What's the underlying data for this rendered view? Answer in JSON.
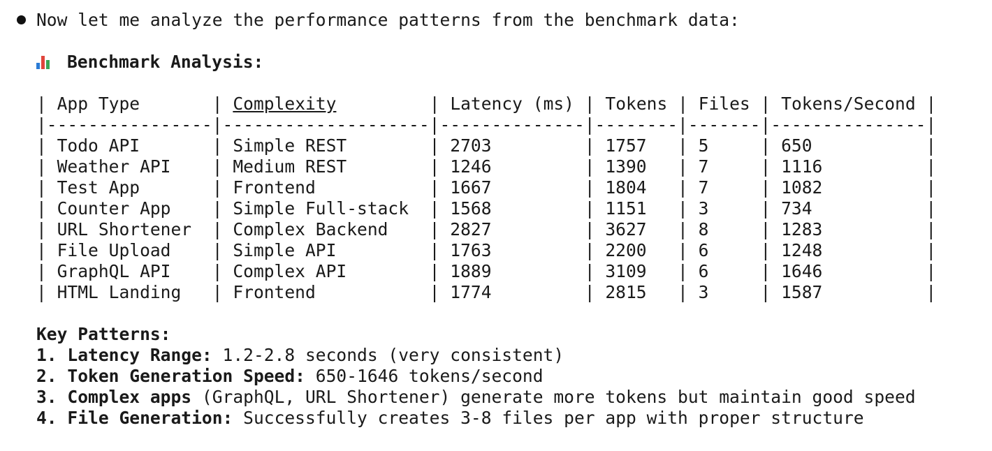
{
  "intro": {
    "text": "Now let me analyze the performance patterns from the benchmark data:"
  },
  "analysis": {
    "icon": "bar-chart-icon",
    "title": "Benchmark Analysis:"
  },
  "table": {
    "header_line": "| App Type       | Complexity         | Latency (ms) | Tokens | Files | Tokens/Second |",
    "headers": [
      "App Type",
      "Complexity",
      "Latency (ms)",
      "Tokens",
      "Files",
      "Tokens/Second"
    ],
    "separator": "|----------------|--------------------|--------------|--------|-------|---------------|",
    "rows": [
      "| Todo API       | Simple REST        | 2703         | 1757   | 5     | 650           |",
      "| Weather API    | Medium REST        | 1246         | 1390   | 7     | 1116          |",
      "| Test App       | Frontend           | 1667         | 1804   | 7     | 1082          |",
      "| Counter App    | Simple Full-stack  | 1568         | 1151   | 3     | 734           |",
      "| URL Shortener  | Complex Backend    | 2827         | 3627   | 8     | 1283          |",
      "| File Upload    | Simple API         | 1763         | 2200   | 6     | 1248          |",
      "| GraphQL API    | Complex API        | 1889         | 3109   | 6     | 1646          |",
      "| HTML Landing   | Frontend           | 1774         | 2815   | 3     | 1587          |"
    ]
  },
  "patterns": {
    "title": "Key Patterns:",
    "items": [
      {
        "num": "1. ",
        "bold": "Latency Range:",
        "rest": " 1.2-2.8 seconds (very consistent)"
      },
      {
        "num": "2. ",
        "bold": "Token Generation Speed:",
        "rest": " 650-1646 tokens/second"
      },
      {
        "num": "3. ",
        "bold": "Complex apps",
        "rest": " (GraphQL, URL Shortener) generate more tokens but maintain good speed"
      },
      {
        "num": "4. ",
        "bold": "File Generation:",
        "rest": " Successfully creates 3-8 files per app with proper structure"
      }
    ]
  },
  "colors": {
    "text": "#1a1a1a",
    "icon_bar_1": "#2b7bd6",
    "icon_bar_2": "#e0463c",
    "icon_bar_3": "#3aa655"
  }
}
